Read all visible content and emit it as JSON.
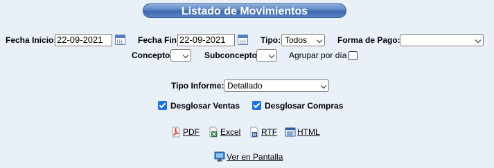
{
  "title": "Listado de Movimientos",
  "filters": {
    "fecha_inicio_label": "Fecha Inicio:",
    "fecha_inicio_value": "22-09-2021",
    "fecha_fin_label": "Fecha Fin:",
    "fecha_fin_value": "22-09-2021",
    "tipo_label": "Tipo:",
    "tipo_value": "Todos",
    "forma_pago_label": "Forma de Pago:",
    "forma_pago_value": "",
    "concepto_label": "Concepto",
    "concepto_value": "",
    "subconcepto_label": "Subconcepto",
    "subconcepto_value": "",
    "agrupar_label": "Agrupar por día"
  },
  "report": {
    "tipo_informe_label": "Tipo Informe:",
    "tipo_informe_value": "Detallado",
    "desglosar_ventas_label": "Desglosar Ventas",
    "desglosar_compras_label": "Desglosar Compras"
  },
  "exports": {
    "pdf": "PDF",
    "excel": "Excel",
    "rtf": "RTF",
    "html": "HTML"
  },
  "ver_pantalla": "Ver en Pantalla",
  "colors": {
    "background": "#e9f0f8",
    "title_bar": "#4a76b8",
    "checkbox_checked": "#1a73e8"
  }
}
